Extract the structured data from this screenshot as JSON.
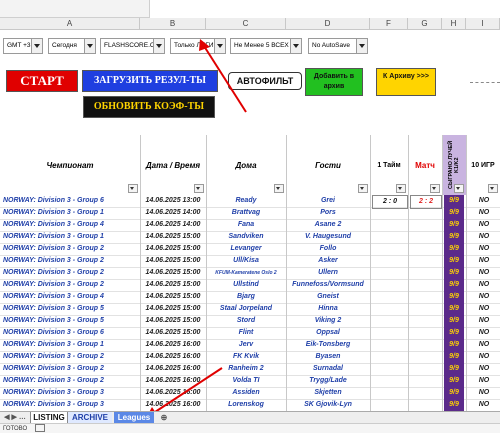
{
  "columns": [
    "A",
    "B",
    "C",
    "D",
    "F",
    "G",
    "H",
    "I"
  ],
  "controls": {
    "timezone": "GMT +3",
    "day": "Сегодня",
    "source": "FLASHSCORE.CC",
    "filter_mode": "Только ЛИГИ",
    "min_filter": "Не Менее 5 ВСЕХ",
    "autosave": "No AutoSave",
    "start_label": "СТАРТ",
    "load_results_label": "ЗАГРУЗИТЬ РЕЗУЛ-ТЫ",
    "autofilter_label": "АВТОФИЛЬТ",
    "add_archive_label": "Добавить в архив",
    "to_archive_label": "К Архиву >>>",
    "update_odds_label": "ОБНОВИТЬ КОЭФ-ТЫ"
  },
  "headers": {
    "league": "Чемпионат",
    "datetime": "Дата / Время",
    "home": "Дома",
    "away": "Гости",
    "half1": "1 Тайм",
    "match": "Матч",
    "played": "СЫГРАНО ЛУЧЕЙ K1/K2",
    "games10": "10 ИГР"
  },
  "rows": [
    {
      "league": "NORWAY: Division 3 - Group 6",
      "datetime": "14.06.2025 13:00",
      "home": "Ready",
      "away": "Grei",
      "half1": "2 : 0",
      "match": "2 : 2",
      "played": "9/9",
      "games10": "NO"
    },
    {
      "league": "NORWAY: Division 3 - Group 1",
      "datetime": "14.06.2025 14:00",
      "home": "Brattvag",
      "away": "Pors",
      "half1": "",
      "match": "",
      "played": "9/9",
      "games10": "NO"
    },
    {
      "league": "NORWAY: Division 3 - Group 4",
      "datetime": "14.06.2025 14:00",
      "home": "Fana",
      "away": "Asane 2",
      "half1": "",
      "match": "",
      "played": "9/9",
      "games10": "NO"
    },
    {
      "league": "NORWAY: Division 3 - Group 1",
      "datetime": "14.06.2025 15:00",
      "home": "Sandviken",
      "away": "V. Haugesund",
      "half1": "",
      "match": "",
      "played": "9/9",
      "games10": "NO"
    },
    {
      "league": "NORWAY: Division 3 - Group 2",
      "datetime": "14.06.2025 15:00",
      "home": "Levanger",
      "away": "Follo",
      "half1": "",
      "match": "",
      "played": "9/9",
      "games10": "NO"
    },
    {
      "league": "NORWAY: Division 3 - Group 2",
      "datetime": "14.06.2025 15:00",
      "home": "Ull/Kisa",
      "away": "Asker",
      "half1": "",
      "match": "",
      "played": "9/9",
      "games10": "NO"
    },
    {
      "league": "NORWAY: Division 3 - Group 2",
      "datetime": "14.06.2025 15:00",
      "home": "KFUM-Kameratene Oslo 2",
      "away": "Ullern",
      "half1": "",
      "match": "",
      "played": "9/9",
      "games10": "NO"
    },
    {
      "league": "NORWAY: Division 3 - Group 2",
      "datetime": "14.06.2025 15:00",
      "home": "Ullstind",
      "away": "Funnefoss/Vormsund",
      "half1": "",
      "match": "",
      "played": "9/9",
      "games10": "NO"
    },
    {
      "league": "NORWAY: Division 3 - Group 4",
      "datetime": "14.06.2025 15:00",
      "home": "Bjarg",
      "away": "Gneist",
      "half1": "",
      "match": "",
      "played": "9/9",
      "games10": "NO"
    },
    {
      "league": "NORWAY: Division 3 - Group 5",
      "datetime": "14.06.2025 15:00",
      "home": "Staal Jorpeland",
      "away": "Hinna",
      "half1": "",
      "match": "",
      "played": "9/9",
      "games10": "NO"
    },
    {
      "league": "NORWAY: Division 3 - Group 5",
      "datetime": "14.06.2025 15:00",
      "home": "Stord",
      "away": "Viking 2",
      "half1": "",
      "match": "",
      "played": "9/9",
      "games10": "NO"
    },
    {
      "league": "NORWAY: Division 3 - Group 6",
      "datetime": "14.06.2025 15:00",
      "home": "Flint",
      "away": "Oppsal",
      "half1": "",
      "match": "",
      "played": "9/9",
      "games10": "NO"
    },
    {
      "league": "NORWAY: Division 3 - Group 1",
      "datetime": "14.06.2025 16:00",
      "home": "Jerv",
      "away": "Eik-Tonsberg",
      "half1": "",
      "match": "",
      "played": "9/9",
      "games10": "NO"
    },
    {
      "league": "NORWAY: Division 3 - Group 2",
      "datetime": "14.06.2025 16:00",
      "home": "FK Kvik",
      "away": "Byasen",
      "half1": "",
      "match": "",
      "played": "9/9",
      "games10": "NO"
    },
    {
      "league": "NORWAY: Division 3 - Group 2",
      "datetime": "14.06.2025 16:00",
      "home": "Ranheim 2",
      "away": "Surnadal",
      "half1": "",
      "match": "",
      "played": "9/9",
      "games10": "NO"
    },
    {
      "league": "NORWAY: Division 3 - Group 2",
      "datetime": "14.06.2025 16:00",
      "home": "Volda TI",
      "away": "Trygg/Lade",
      "half1": "",
      "match": "",
      "played": "9/9",
      "games10": "NO"
    },
    {
      "league": "NORWAY: Division 3 - Group 3",
      "datetime": "14.06.2025 16:00",
      "home": "Assiden",
      "away": "Skjetten",
      "half1": "",
      "match": "",
      "played": "9/9",
      "games10": "NO"
    },
    {
      "league": "NORWAY: Division 3 - Group 3",
      "datetime": "14.06.2025 16:00",
      "home": "Lorenskog",
      "away": "SK Gjovik-Lyn",
      "half1": "",
      "match": "",
      "played": "9/9",
      "games10": "NO"
    }
  ],
  "sheet_tabs": [
    "LISTING",
    "ARCHIVE",
    "Leagues"
  ],
  "status_text": "ГОТОВО",
  "colors": {
    "accent_red": "#e00000",
    "button_blue": "#1f3fe0",
    "button_green": "#22c020",
    "button_yellow": "#ffd400",
    "played_bg": "#5b2a8a",
    "played_fg": "#ffd400"
  }
}
